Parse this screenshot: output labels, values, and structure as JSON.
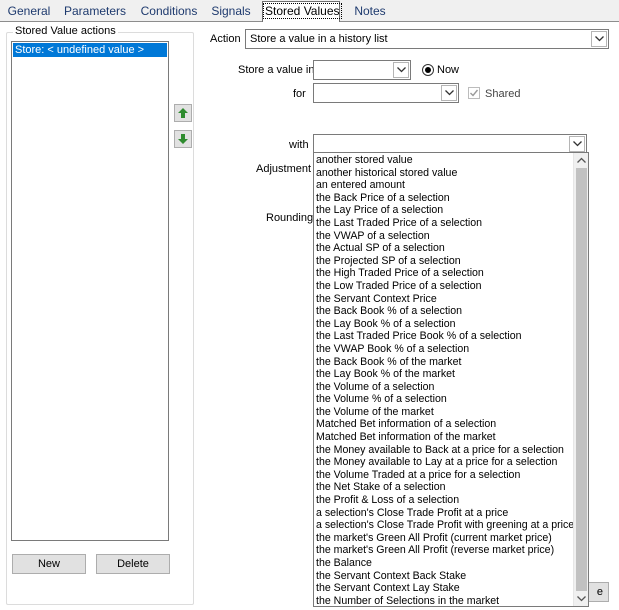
{
  "tabs": [
    {
      "label": "General"
    },
    {
      "label": "Parameters"
    },
    {
      "label": "Conditions"
    },
    {
      "label": "Signals"
    },
    {
      "label": "Stored Values"
    },
    {
      "label": "Notes"
    }
  ],
  "active_tab": "Stored Values",
  "actions_group": {
    "title": "Stored Value actions",
    "items": [
      "Store: < undefined value >"
    ],
    "new_label": "New",
    "delete_label": "Delete"
  },
  "form": {
    "action_label": "Action",
    "action_value": "Store a value in a history list",
    "store_in_label": "Store a value in",
    "store_in_value": "",
    "now_label": "Now",
    "for_label": "for",
    "for_value": "",
    "shared_label": "Shared",
    "with_label": "with",
    "with_value": "",
    "adjustment_label": "Adjustment",
    "rounding_label": "Rounding"
  },
  "with_options": [
    "another stored value",
    "another historical stored value",
    "an entered amount",
    "the Back Price of a selection",
    "the Lay Price of a selection",
    "the Last Traded Price of a selection",
    "the VWAP of a selection",
    "the Actual SP of a selection",
    "the Projected SP of a selection",
    "the High Traded Price of a selection",
    "the Low Traded Price of a selection",
    "the Servant Context Price",
    "the Back Book % of a selection",
    "the Lay Book % of a selection",
    "the Last Traded Price Book % of a selection",
    "the VWAP Book % of a selection",
    "the Back Book % of the market",
    "the Lay Book % of the market",
    "the Volume of a selection",
    "the Volume % of a selection",
    "the Volume of the market",
    "Matched Bet information of a selection",
    "Matched Bet information of the market",
    "the Money available to Back at a price for a selection",
    "the Money available to Lay at a price for a selection",
    "the Volume Traded at a price for a selection",
    "the Net Stake of a selection",
    "the Profit & Loss of a selection",
    "a selection's Close Trade Profit at a price",
    "a selection's Close Trade Profit with greening at a price",
    "the market's Green All Profit (current market price)",
    "the market's Green All Profit (reverse market price)",
    "the Balance",
    "the Servant Context Back Stake",
    "the Servant Context Lay Stake",
    "the Number of Selections in the market"
  ],
  "hidden_button_peek": "e",
  "colors": {
    "selection": "#0078d7",
    "tab_text": "#1e3a6e",
    "arrow_green": "#2e8b2e"
  },
  "icons": {
    "move_up": "arrow-up-icon",
    "move_down": "arrow-down-icon",
    "dropdown": "chevron-down-icon"
  }
}
